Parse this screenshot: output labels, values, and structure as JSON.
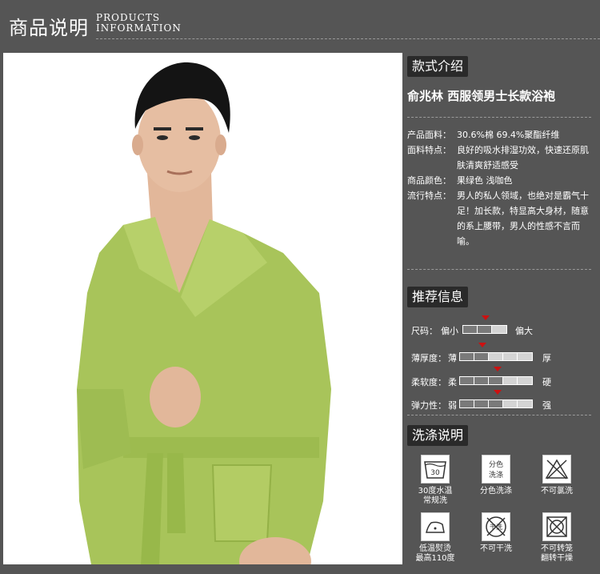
{
  "header": {
    "title_cn": "商品说明",
    "title_en_line1": "PRODUCTS",
    "title_en_line2": "INFORMATION"
  },
  "style_section": {
    "tag": "款式介绍",
    "product_name": "俞兆林 西服领男士长款浴袍",
    "specs": [
      {
        "key": "产品面料：",
        "value": "30.6%棉 69.4%聚酯纤维"
      },
      {
        "key": "面料特点：",
        "value": "良好的吸水排湿功效，快速还原肌肤清爽舒适感受"
      },
      {
        "key": "商品颜色：",
        "value": "果绿色 浅咖色"
      },
      {
        "key": "流行特点：",
        "value": "男人的私人领域，也绝对是霸气十足！加长款，特显高大身材，随意的系上腰带，男人的性感不言而喻。"
      }
    ]
  },
  "recommend_section": {
    "tag": "推荐信息",
    "meters": [
      {
        "label": "尺码：",
        "low": "偏小",
        "high": "偏大",
        "segments": 3,
        "level": 0.5
      },
      {
        "label": "薄厚度：",
        "low": "薄",
        "high": "厚",
        "segments": 5,
        "level": 0.3
      },
      {
        "label": "柔软度：",
        "low": "柔",
        "high": "硬",
        "segments": 5,
        "level": 0.5
      },
      {
        "label": "弹力性：",
        "low": "弱",
        "high": "强",
        "segments": 5,
        "level": 0.5
      }
    ],
    "marker_color": "#cc1111"
  },
  "wash_section": {
    "tag": "洗涤说明",
    "items": [
      {
        "icon": "wash-30-icon",
        "icon_text": "30",
        "label1": "30度水温",
        "label2": "常规洗"
      },
      {
        "icon": "separate-wash-icon",
        "icon_text": "分色洗涤",
        "label1": "分色洗涤",
        "label2": ""
      },
      {
        "icon": "no-bleach-icon",
        "icon_text": "",
        "label1": "不可氯洗",
        "label2": ""
      },
      {
        "icon": "low-iron-icon",
        "icon_text": "",
        "label1": "低温熨烫",
        "label2": "最高110度"
      },
      {
        "icon": "no-dry-clean-icon",
        "icon_text": "干洗",
        "label1": "不可干洗",
        "label2": ""
      },
      {
        "icon": "no-tumble-dry-icon",
        "icon_text": "",
        "label1": "不可转笼",
        "label2": "翻转干燥"
      }
    ]
  },
  "colors": {
    "panel_bg": "#555555",
    "tag_bg": "#2a2a2a",
    "robe_green": "#a8c45a"
  }
}
